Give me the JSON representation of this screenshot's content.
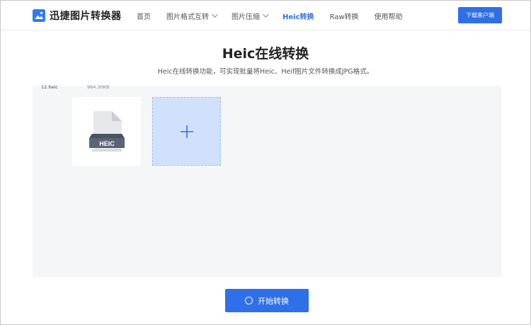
{
  "header": {
    "logo_text": "迅捷图片转换器",
    "download_label": "下载客户端",
    "nav": [
      {
        "label": "首页",
        "dropdown": false,
        "active": false
      },
      {
        "label": "图片格式互转",
        "dropdown": true,
        "active": false
      },
      {
        "label": "图片压缩",
        "dropdown": true,
        "active": false
      },
      {
        "label": "Heic转换",
        "dropdown": false,
        "active": true
      },
      {
        "label": "Raw转换",
        "dropdown": false,
        "active": false
      },
      {
        "label": "使用帮助",
        "dropdown": false,
        "active": false
      }
    ]
  },
  "main": {
    "title": "Heic在线转换",
    "subtitle": "Heic在线转换功能，可实现批量将Heic、Heif图片文件转换成JPG格式。",
    "file": {
      "icon_label": "HEIC",
      "name": "12.heic",
      "size": "964.30KB"
    },
    "add_symbol": "+",
    "start_label": "开始转换"
  },
  "colors": {
    "accent": "#2f6fe8",
    "add_tile": "#d2e1fb",
    "workspace": "#f5f6f8"
  }
}
